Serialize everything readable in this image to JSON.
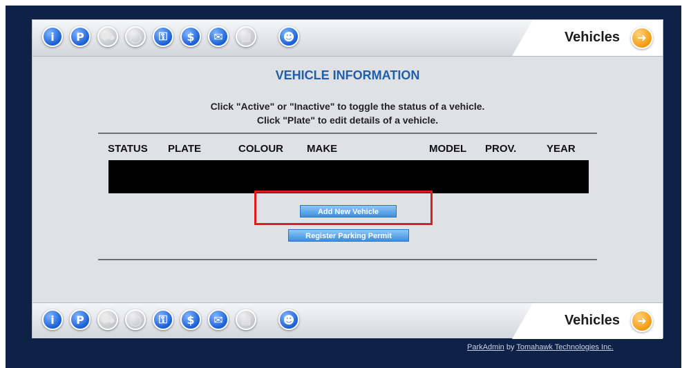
{
  "toolbar": {
    "icons": [
      {
        "name": "info-icon",
        "glyph": "i",
        "state": "active"
      },
      {
        "name": "parking-icon",
        "glyph": "P",
        "state": "active"
      },
      {
        "name": "car-icon",
        "glyph": "⛟",
        "state": "disabled"
      },
      {
        "name": "ticket-icon",
        "glyph": "◯",
        "state": "disabled"
      },
      {
        "name": "lock-icon",
        "glyph": "⚿",
        "state": "active"
      },
      {
        "name": "dollar-icon",
        "glyph": "$",
        "state": "active"
      },
      {
        "name": "message-icon",
        "glyph": "✉",
        "state": "active"
      },
      {
        "name": "clipboard-icon",
        "glyph": "▤",
        "state": "disabled"
      },
      {
        "name": "user-icon",
        "glyph": "☻",
        "state": "active"
      }
    ],
    "tab_label": "Vehicles"
  },
  "page": {
    "title": "VEHICLE INFORMATION",
    "instruction_1": "Click \"Active\" or \"Inactive\" to toggle the status of a vehicle.",
    "instruction_2": "Click \"Plate\" to edit details of a vehicle."
  },
  "table": {
    "columns": [
      "STATUS",
      "PLATE",
      "COLOUR",
      "MAKE",
      "MODEL",
      "PROV.",
      "YEAR"
    ]
  },
  "buttons": {
    "add_vehicle": "Add New Vehicle",
    "register_permit": "Register Parking Permit"
  },
  "footer": {
    "app": "ParkAdmin",
    "by": "by",
    "company": "Tomahawk Technologies Inc."
  },
  "colors": {
    "frame": "#0e2146",
    "title": "#1f5faa",
    "highlight": "#e21b1b",
    "tab_icon": "#f39a12"
  }
}
